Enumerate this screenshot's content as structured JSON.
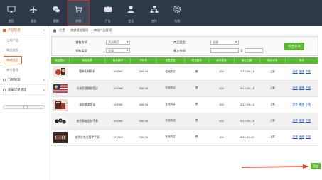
{
  "nav": [
    {
      "label": "首页",
      "icon": "monitor-icon"
    },
    {
      "label": "服务",
      "icon": "plane-icon"
    },
    {
      "label": "圈圈",
      "icon": "chat-icon"
    },
    {
      "label": "商城",
      "icon": "cart-icon",
      "active": true
    },
    {
      "label": "广告",
      "icon": "tv-icon"
    },
    {
      "label": "会员",
      "icon": "user-icon"
    },
    {
      "label": "合作",
      "icon": "network-icon"
    },
    {
      "label": "系统",
      "icon": "gear-icon"
    }
  ],
  "sidebar": {
    "group1": "产品管理",
    "items": [
      "上架产品",
      "商品类别",
      "商城商品",
      "单位管理"
    ],
    "active_item": 2,
    "group2": "订单管理",
    "group3": "商家订单管理"
  },
  "breadcrumb": [
    "位置",
    "商城管理管理",
    "商城产品管理"
  ],
  "filter": {
    "label_sale_mode": "销售方式",
    "sale_mode_value": "活动购买",
    "label_category": "商品类型",
    "category_value": "全部",
    "label_sale_type": "销售类型",
    "sale_type_value": "全部",
    "label_deadline": "截止时间",
    "to_label": "至",
    "query_button": "综合查询"
  },
  "table": {
    "headers": [
      "商品图片",
      "商品名称",
      "商品编号",
      "市场价",
      "销售类型",
      "物流服务",
      "库存数量",
      "截止日期",
      "商品状态",
      "操作"
    ],
    "rows": [
      {
        "name": "腰带无线耳机",
        "code": "100767",
        "price": "200.00",
        "type": "在线购买",
        "logistics": "是",
        "stock": "100",
        "deadline": "2017-09-11",
        "status": "上架",
        "thumb": "product-red"
      },
      {
        "name": "马来西亚旅游签证",
        "code": "100766",
        "price": "350.00",
        "type": "在线购买",
        "logistics": "是",
        "stock": "100",
        "deadline": "2017-09-11",
        "status": "上架",
        "thumb": "flag-malaysia"
      },
      {
        "name": "泰国旅游签证",
        "code": "100765",
        "price": "400.00",
        "type": "在线购买",
        "logistics": "是",
        "stock": "100",
        "deadline": "2017-09-11",
        "status": "上架",
        "thumb": "product-brown"
      },
      {
        "name": "安然高端定制手表",
        "code": "100764",
        "price": "500.00",
        "type": "在线购买",
        "logistics": "是",
        "stock": "100",
        "deadline": "2017-09-11",
        "status": "上架",
        "thumb": "product-watches"
      },
      {
        "name": "安然红木古董钟手表",
        "code": "100763",
        "price": "700.00",
        "type": "在线购买",
        "logistics": "是",
        "stock": "100",
        "deadline": "2019-10-00",
        "status": "上架",
        "thumb": "product-pens"
      }
    ],
    "ops": [
      "查看",
      "编辑",
      "下架"
    ]
  },
  "add_button": "添加",
  "colors": {
    "accent": "#5bb832",
    "nav_bg": "#2d3948",
    "highlight": "#e56b1f",
    "arrow": "#e23c2e"
  }
}
